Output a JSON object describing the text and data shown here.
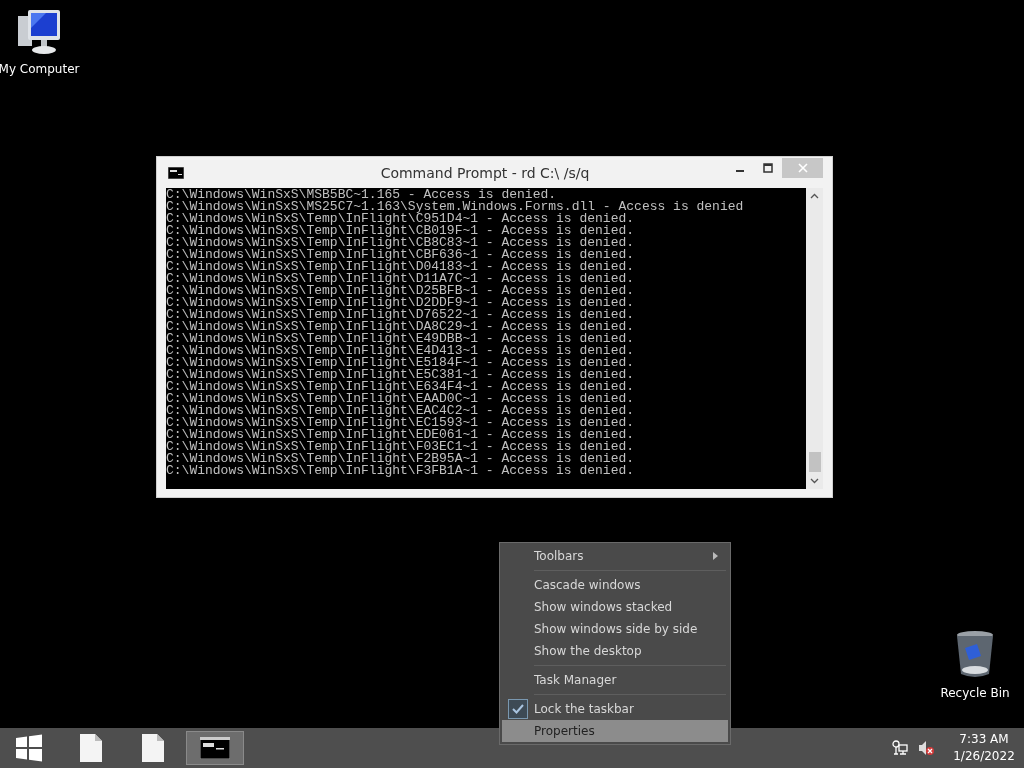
{
  "desktop_icons": [
    {
      "kind": "computer",
      "label": "My Computer"
    },
    {
      "kind": "recycle-bin",
      "label": "Recycle Bin"
    }
  ],
  "window": {
    "title": "Command Prompt - rd  C:\\ /s/q",
    "lines": [
      "C:\\Windows\\WinSxS\\MSB5BC~1.165 - Access is denied.",
      "C:\\Windows\\WinSxS\\MS25C7~1.163\\System.Windows.Forms.dll - Access is denied",
      "C:\\Windows\\WinSxS\\Temp\\InFlight\\C951D4~1 - Access is denied.",
      "C:\\Windows\\WinSxS\\Temp\\InFlight\\CB019F~1 - Access is denied.",
      "C:\\Windows\\WinSxS\\Temp\\InFlight\\CB8C83~1 - Access is denied.",
      "C:\\Windows\\WinSxS\\Temp\\InFlight\\CBF636~1 - Access is denied.",
      "C:\\Windows\\WinSxS\\Temp\\InFlight\\D04183~1 - Access is denied.",
      "C:\\Windows\\WinSxS\\Temp\\InFlight\\D11A7C~1 - Access is denied.",
      "C:\\Windows\\WinSxS\\Temp\\InFlight\\D25BFB~1 - Access is denied.",
      "C:\\Windows\\WinSxS\\Temp\\InFlight\\D2DDF9~1 - Access is denied.",
      "C:\\Windows\\WinSxS\\Temp\\InFlight\\D76522~1 - Access is denied.",
      "C:\\Windows\\WinSxS\\Temp\\InFlight\\DA8C29~1 - Access is denied.",
      "C:\\Windows\\WinSxS\\Temp\\InFlight\\E49DBB~1 - Access is denied.",
      "C:\\Windows\\WinSxS\\Temp\\InFlight\\E4D413~1 - Access is denied.",
      "C:\\Windows\\WinSxS\\Temp\\InFlight\\E5184F~1 - Access is denied.",
      "C:\\Windows\\WinSxS\\Temp\\InFlight\\E5C381~1 - Access is denied.",
      "C:\\Windows\\WinSxS\\Temp\\InFlight\\E634F4~1 - Access is denied.",
      "C:\\Windows\\WinSxS\\Temp\\InFlight\\EAAD0C~1 - Access is denied.",
      "C:\\Windows\\WinSxS\\Temp\\InFlight\\EAC4C2~1 - Access is denied.",
      "C:\\Windows\\WinSxS\\Temp\\InFlight\\EC1593~1 - Access is denied.",
      "C:\\Windows\\WinSxS\\Temp\\InFlight\\EDE061~1 - Access is denied.",
      "C:\\Windows\\WinSxS\\Temp\\InFlight\\F03EC1~1 - Access is denied.",
      "C:\\Windows\\WinSxS\\Temp\\InFlight\\F2B95A~1 - Access is denied.",
      "C:\\Windows\\WinSxS\\Temp\\InFlight\\F3FB1A~1 - Access is denied."
    ]
  },
  "context_menu": {
    "groups": [
      [
        {
          "kind": "submenu",
          "label": "Toolbars",
          "checked": false,
          "selected": false
        }
      ],
      [
        {
          "kind": "item",
          "label": "Cascade windows",
          "checked": false,
          "selected": false
        },
        {
          "kind": "item",
          "label": "Show windows stacked",
          "checked": false,
          "selected": false
        },
        {
          "kind": "item",
          "label": "Show windows side by side",
          "checked": false,
          "selected": false
        },
        {
          "kind": "item",
          "label": "Show the desktop",
          "checked": false,
          "selected": false
        }
      ],
      [
        {
          "kind": "item",
          "label": "Task Manager",
          "checked": false,
          "selected": false
        }
      ],
      [
        {
          "kind": "item",
          "label": "Lock the taskbar",
          "checked": true,
          "selected": false
        },
        {
          "kind": "item",
          "label": "Properties",
          "checked": false,
          "selected": true
        }
      ]
    ]
  },
  "taskbar": {
    "buttons": [
      {
        "kind": "start",
        "active": false
      },
      {
        "kind": "file",
        "active": false
      },
      {
        "kind": "file",
        "active": false
      },
      {
        "kind": "console",
        "active": true
      }
    ],
    "clock": {
      "time": "7:33 AM",
      "date": "1/26/2022"
    }
  }
}
